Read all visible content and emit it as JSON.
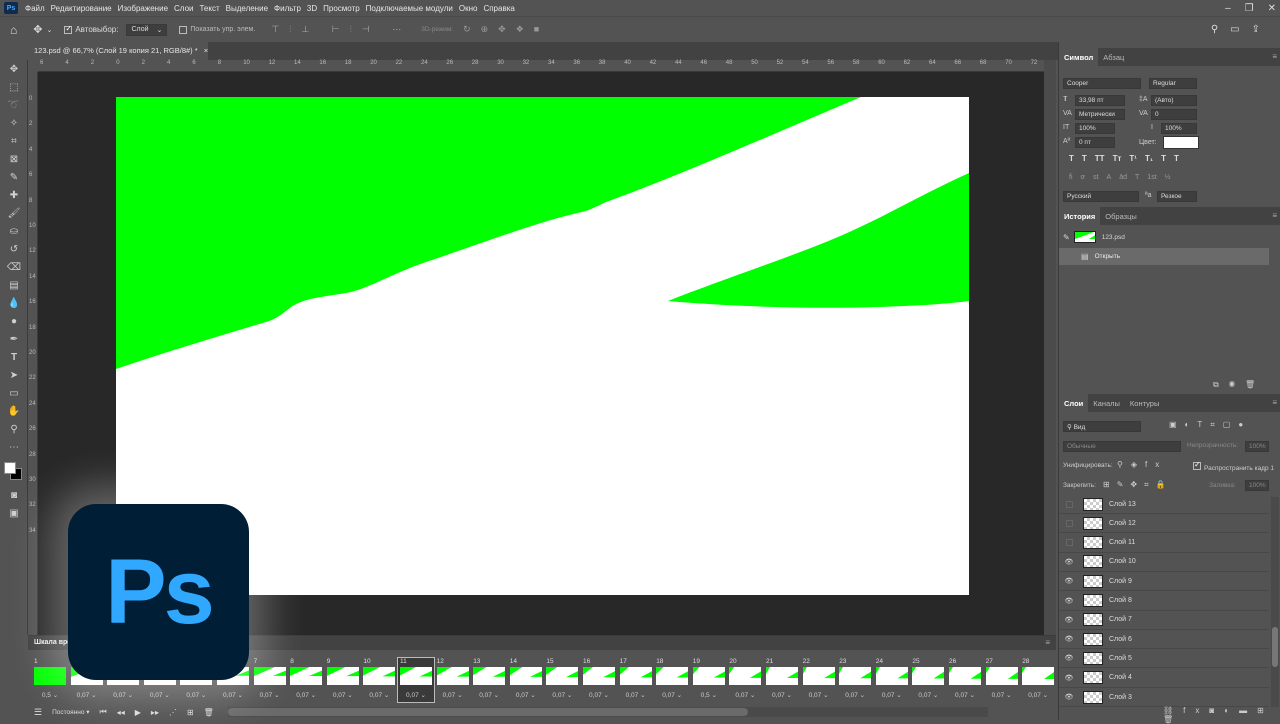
{
  "app": {
    "logo_text": "Ps",
    "menu": [
      "Файл",
      "Редактирование",
      "Изображение",
      "Слои",
      "Текст",
      "Выделение",
      "Фильтр",
      "3D",
      "Просмотр",
      "Подключаемые модули",
      "Окно",
      "Справка"
    ]
  },
  "options": {
    "autoselect_label": "Автовыбор:",
    "autoselect_target": "Слой",
    "show_transform_label": "Показать упр. элем.",
    "mode3d_label": "3D-режим:"
  },
  "document": {
    "tab_title": "123.psd @ 66,7% (Слой 19 копия 21, RGB/8#) *",
    "ruler_ticks": [
      "6",
      "4",
      "2",
      "0",
      "2",
      "4",
      "6",
      "8",
      "10",
      "12",
      "14",
      "16",
      "18",
      "20",
      "22",
      "24",
      "26",
      "28",
      "30",
      "32",
      "34",
      "36",
      "38",
      "40",
      "42",
      "44",
      "46",
      "48",
      "50",
      "52",
      "54",
      "56",
      "58",
      "60",
      "62",
      "64",
      "66",
      "68",
      "70",
      "72"
    ],
    "ruler_vticks": [
      "0",
      "2",
      "4",
      "6",
      "8",
      "10",
      "12",
      "14",
      "16",
      "18",
      "20",
      "22",
      "24",
      "26",
      "28",
      "30",
      "32",
      "34"
    ],
    "colors": {
      "green": "#00ff00",
      "white": "#ffffff"
    }
  },
  "character": {
    "tabs": [
      "Символ",
      "Абзац"
    ],
    "font_family": "Cooper",
    "font_style": "Regular",
    "size": "33,98 пт",
    "leading": "(Авто)",
    "kerning": "Метрически",
    "tracking": "0",
    "vscale": "100%",
    "hscale": "100%",
    "baseline": "0 пт",
    "color_label": "Цвет:",
    "language": "Русский",
    "antialias": "Резкое",
    "style_buttons": [
      "T",
      "T",
      "TT",
      "Tт",
      "T¹",
      "T₁",
      "T",
      "T"
    ],
    "ot_buttons": [
      "fi",
      "ơ",
      "st",
      "A",
      "ād",
      "T",
      "1st",
      "½"
    ]
  },
  "history": {
    "tabs": [
      "История",
      "Образцы"
    ],
    "snapshot_label": "123.psd",
    "items": [
      "Открыть"
    ]
  },
  "layers": {
    "tabs": [
      "Слои",
      "Каналы",
      "Контуры"
    ],
    "filter_label": "Вид",
    "blend_mode": "Обычные",
    "opacity_label": "Непрозрачность:",
    "opacity_value": "100%",
    "unify_label": "Унифицировать:",
    "propagate_label": "Распространить кадр 1",
    "lock_label": "Закрепить:",
    "fill_label": "Заливка:",
    "fill_value": "100%",
    "items": [
      {
        "name": "Слой 13",
        "visible": false
      },
      {
        "name": "Слой 12",
        "visible": false
      },
      {
        "name": "Слой 11",
        "visible": false
      },
      {
        "name": "Слой 10",
        "visible": true
      },
      {
        "name": "Слой 9",
        "visible": true
      },
      {
        "name": "Слой 8",
        "visible": true
      },
      {
        "name": "Слой 7",
        "visible": true
      },
      {
        "name": "Слой 6",
        "visible": true
      },
      {
        "name": "Слой 5",
        "visible": true
      },
      {
        "name": "Слой 4",
        "visible": true
      },
      {
        "name": "Слой 3",
        "visible": true
      }
    ]
  },
  "timeline": {
    "title": "Шкала вре",
    "loop": "Постоянно",
    "selected_frame": 11,
    "frames": [
      {
        "n": "1",
        "d": "0,5"
      },
      {
        "n": "2",
        "d": "0,07"
      },
      {
        "n": "3",
        "d": "0,07"
      },
      {
        "n": "4",
        "d": "0,07"
      },
      {
        "n": "5",
        "d": "0,07"
      },
      {
        "n": "6",
        "d": "0,07"
      },
      {
        "n": "7",
        "d": "0,07"
      },
      {
        "n": "8",
        "d": "0,07"
      },
      {
        "n": "9",
        "d": "0,07"
      },
      {
        "n": "10",
        "d": "0,07"
      },
      {
        "n": "11",
        "d": "0,07"
      },
      {
        "n": "12",
        "d": "0,07"
      },
      {
        "n": "13",
        "d": "0,07"
      },
      {
        "n": "14",
        "d": "0,07"
      },
      {
        "n": "15",
        "d": "0,07"
      },
      {
        "n": "16",
        "d": "0,07"
      },
      {
        "n": "17",
        "d": "0,07"
      },
      {
        "n": "18",
        "d": "0,07"
      },
      {
        "n": "19",
        "d": "0,5"
      },
      {
        "n": "20",
        "d": "0,07"
      },
      {
        "n": "21",
        "d": "0,07"
      },
      {
        "n": "22",
        "d": "0,07"
      },
      {
        "n": "23",
        "d": "0,07"
      },
      {
        "n": "24",
        "d": "0,07"
      },
      {
        "n": "25",
        "d": "0,07"
      },
      {
        "n": "26",
        "d": "0,07"
      },
      {
        "n": "27",
        "d": "0,07"
      },
      {
        "n": "28",
        "d": "0,07"
      }
    ]
  }
}
